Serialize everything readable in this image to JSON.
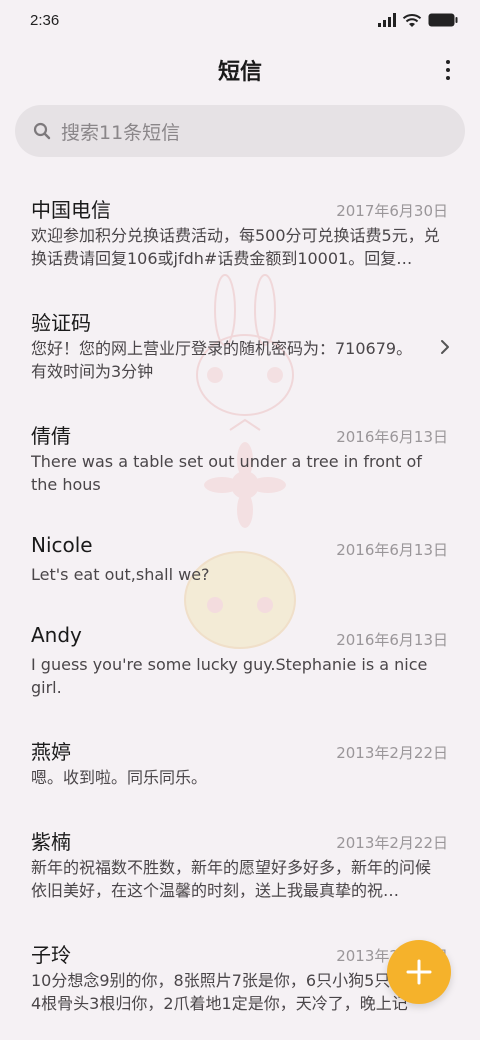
{
  "status": {
    "time": "2:36"
  },
  "header": {
    "title": "短信"
  },
  "search": {
    "placeholder": "搜索11条短信"
  },
  "colors": {
    "accent": "#f5b22b",
    "background": "#f5f1f4",
    "search_bg": "#e6e2e5"
  },
  "messages": [
    {
      "name": "中国电信",
      "date": "2017年6月30日",
      "preview": "欢迎参加积分兑换话费活动，每500分可兑换话费5元，兑换话费请回复106或jfdh#话费金额到10001。回复…"
    },
    {
      "name": "验证码",
      "date": "",
      "preview": "您好！您的网上营业厅登录的随机密码为：710679。有效时间为3分钟"
    },
    {
      "name": "倩倩",
      "date": "2016年6月13日",
      "preview": "There was a table set out under a tree in front of the hous"
    },
    {
      "name": "Nicole",
      "date": "2016年6月13日",
      "preview": "Let's eat out,shall we?"
    },
    {
      "name": "Andy",
      "date": "2016年6月13日",
      "preview": "I guess you're some lucky guy.Stephanie is a nice girl."
    },
    {
      "name": "燕婷",
      "date": "2013年2月22日",
      "preview": "嗯。收到啦。同乐同乐。"
    },
    {
      "name": "紫楠",
      "date": "2013年2月22日",
      "preview": "新年的祝福数不胜数，新年的愿望好多好多，新年的问候依旧美好，在这个温馨的时刻，送上我最真挚的祝…"
    },
    {
      "name": "子玲",
      "date": "2013年2月22日",
      "preview": "10分想念9别的你，8张照片7张是你，6只小狗5只像你，4根骨头3根归你，2爪着地1定是你，天冷了，晚上记"
    }
  ]
}
